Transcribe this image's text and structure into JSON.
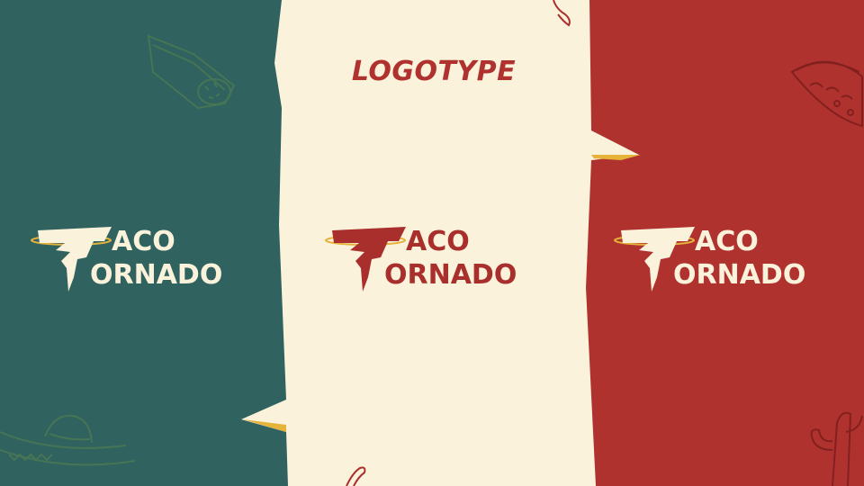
{
  "heading": {
    "text": "LOGOTYPE"
  },
  "logo": {
    "line1": "ACO",
    "line2": "ORNADO",
    "brand_name": "TACO TORNADO"
  },
  "colors": {
    "teal": "#30625F",
    "cream": "#FBF2DC",
    "red": "#B0322F",
    "logo_red": "#A92F2C",
    "gold": "#E5B23A"
  },
  "icons": [
    "burrito-icon",
    "taco-icon",
    "sombrero-icon",
    "chili-pepper-icon",
    "cactus-icon"
  ]
}
